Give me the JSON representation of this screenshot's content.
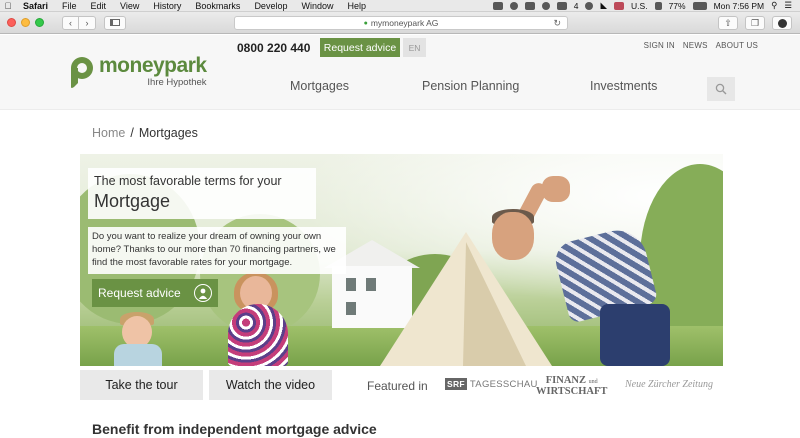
{
  "menubar": {
    "app": "Safari",
    "items": [
      "File",
      "Edit",
      "View",
      "History",
      "Bookmarks",
      "Develop",
      "Window",
      "Help"
    ],
    "input_source": "U.S.",
    "battery": "77%",
    "clock": "Mon 7:56 PM",
    "tray_badge": "4"
  },
  "browser": {
    "address": "mymoneypark AG",
    "back_icon": "chevron-left-icon",
    "forward_icon": "chevron-right-icon"
  },
  "header": {
    "logo_name": "moneypark",
    "logo_sub": "Ihre Hypothek",
    "phone": "0800 220 440",
    "request_advice": "Request advice",
    "lang": "EN",
    "top_links": [
      "SIGN IN",
      "NEWS",
      "ABOUT US"
    ],
    "nav": [
      "Mortgages",
      "Pension Planning",
      "Investments"
    ],
    "brand_color": "#6a9244"
  },
  "breadcrumb": {
    "home": "Home",
    "separator": "/",
    "current": "Mortgages"
  },
  "hero": {
    "title_line1": "The most favorable terms for your",
    "title_line2": "Mortgage",
    "text": "Do you want to realize your dream of owning your own home? Thanks to our more than 70 financing partners, we find the most favorable rates for your mortgage.",
    "cta": "Request advice"
  },
  "below_hero": {
    "tour": "Take the tour",
    "video": "Watch the video",
    "featured": "Featured in",
    "press": {
      "srf_mark": "SRF",
      "srf_name": "TAGESSCHAU",
      "fw_line1": "FINANZ",
      "fw_line2": "WIRTSCHAFT",
      "fw_small": "und",
      "nzz": "Neue Zürcher Zeitung"
    }
  },
  "section": {
    "benefit_title": "Benefit from independent mortgage advice"
  }
}
